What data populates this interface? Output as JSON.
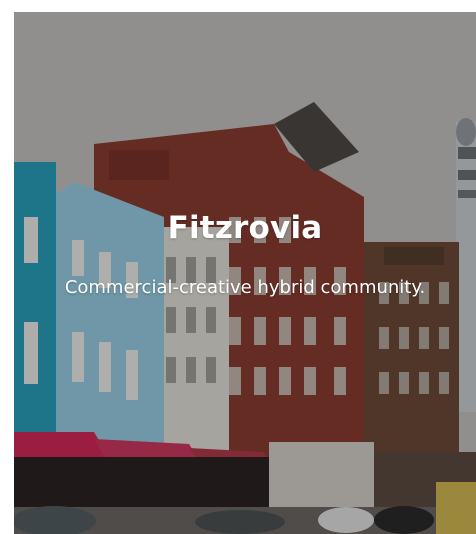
{
  "card": {
    "title": "Fitzrovia",
    "subtitle": "Commercial-creative hybrid community."
  },
  "image": {
    "scene": "London street with colorful terraced buildings and BT Tower",
    "overlay_color": "#000000"
  }
}
